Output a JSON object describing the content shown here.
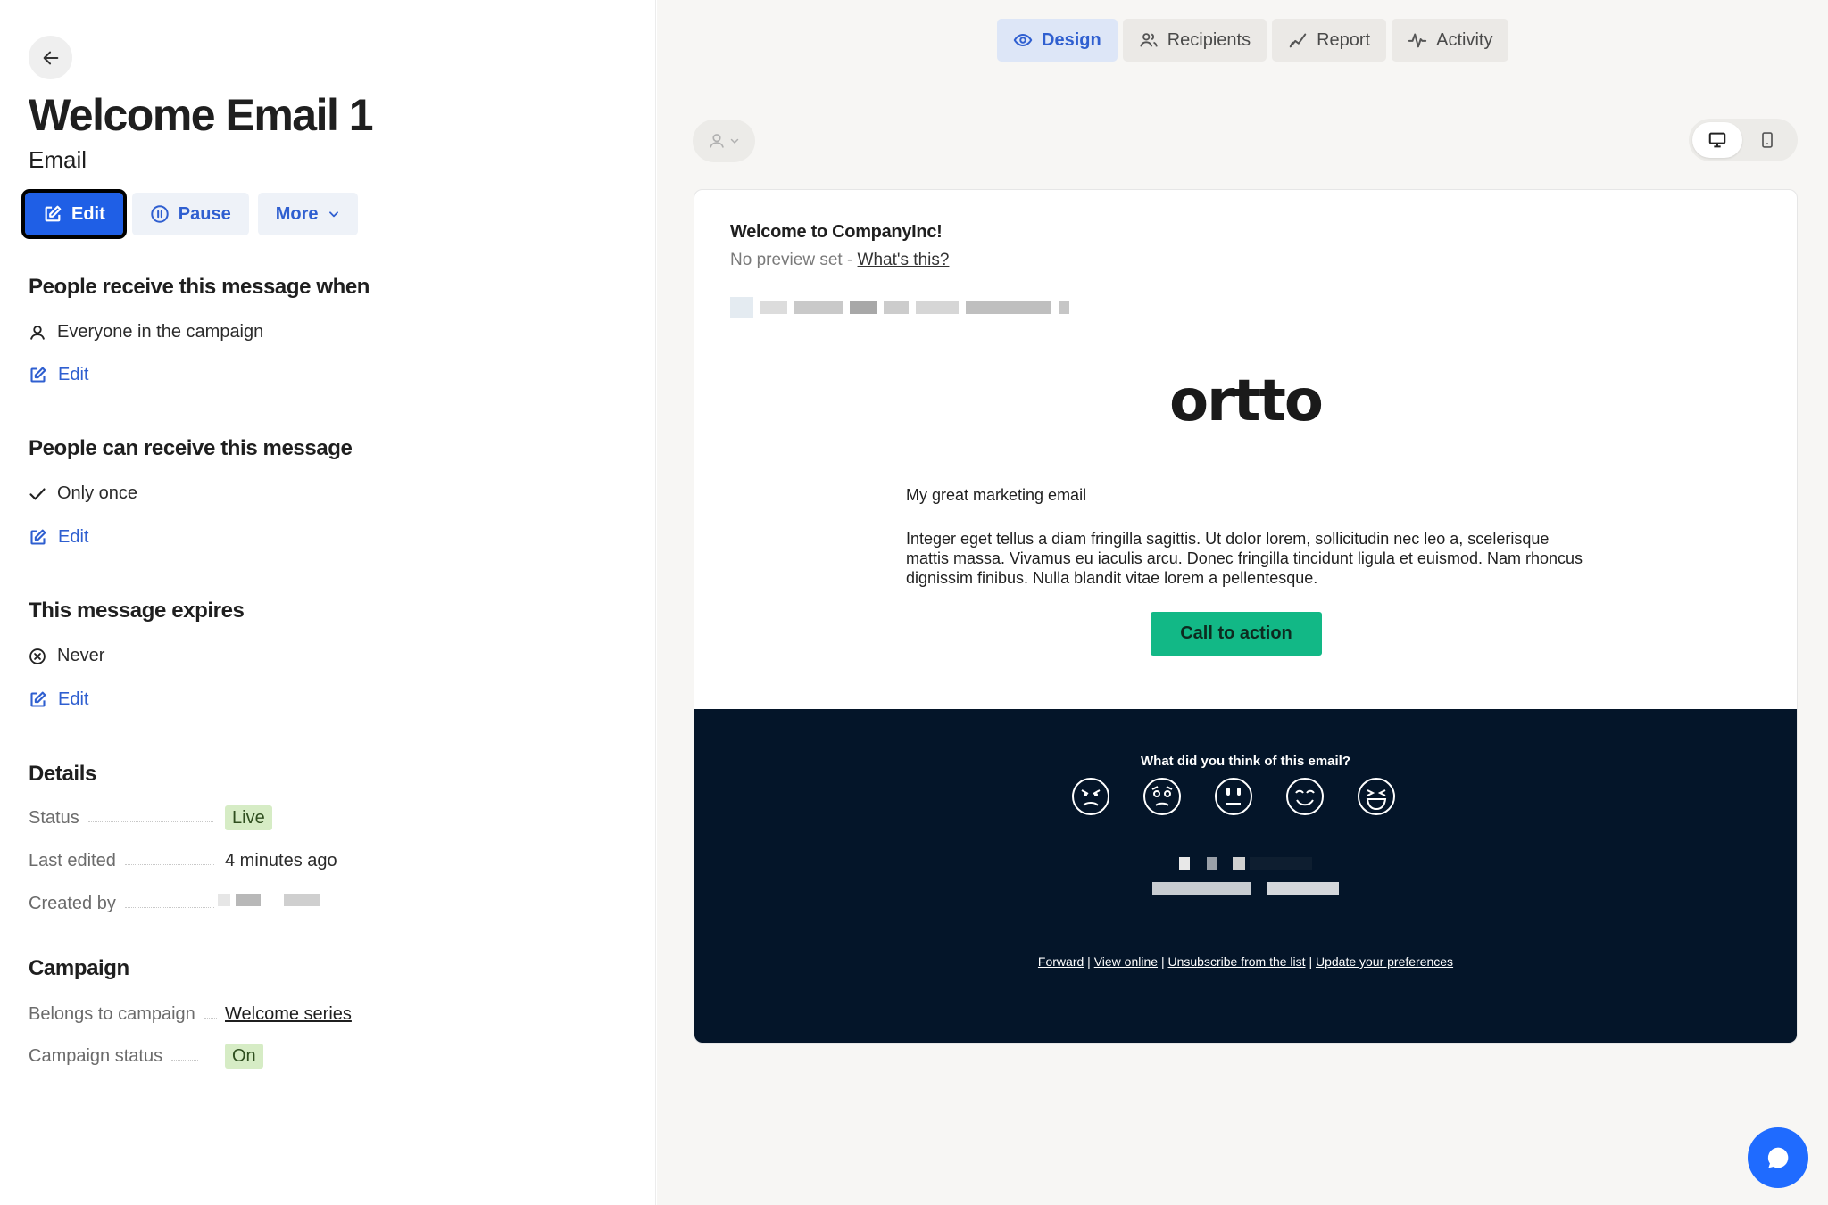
{
  "header": {
    "title": "Welcome Email 1",
    "subtitle": "Email",
    "actions": {
      "edit": "Edit",
      "pause": "Pause",
      "more": "More"
    }
  },
  "sections": {
    "audience": {
      "heading": "People receive this message when",
      "value": "Everyone in the campaign",
      "edit": "Edit"
    },
    "frequency": {
      "heading": "People can receive this message",
      "value": "Only once",
      "edit": "Edit"
    },
    "expiry": {
      "heading": "This message expires",
      "value": "Never",
      "edit": "Edit"
    }
  },
  "details": {
    "heading": "Details",
    "status_label": "Status",
    "status_value": "Live",
    "edited_label": "Last edited",
    "edited_value": "4 minutes ago",
    "created_label": "Created by"
  },
  "campaign": {
    "heading": "Campaign",
    "belongs_label": "Belongs to campaign",
    "belongs_value": "Welcome series",
    "status_label": "Campaign status",
    "status_value": "On"
  },
  "tabs": [
    {
      "label": "Design",
      "icon": "eye-icon",
      "active": true
    },
    {
      "label": "Recipients",
      "icon": "users-icon",
      "active": false
    },
    {
      "label": "Report",
      "icon": "chart-icon",
      "active": false
    },
    {
      "label": "Activity",
      "icon": "pulse-icon",
      "active": false
    }
  ],
  "email": {
    "subject": "Welcome to CompanyInc!",
    "preview_prefix": "No preview set - ",
    "preview_link": "What's this?",
    "logo": "ortto",
    "heading": "My great marketing email",
    "body": "Integer eget tellus a diam fringilla sagittis. Ut dolor lorem, sollicitudin nec leo a, scelerisque mattis massa. Vivamus eu iaculis arcu. Donec fringilla tincidunt ligula et euismod. Nam rhoncus dignissim finibus. Nulla blandit vitae lorem a pellentesque.",
    "cta": "Call to action",
    "footer_question": "What did you think of this email?",
    "footer_links": {
      "forward": "Forward",
      "view_online": "View online",
      "unsubscribe": "Unsubscribe from the list",
      "preferences": "Update your preferences",
      "separator": "|"
    }
  },
  "colors": {
    "accent": "#1f5fe6",
    "cta": "#12b886",
    "footer_bg": "#041529",
    "badge_bg": "#d6ecc5"
  }
}
